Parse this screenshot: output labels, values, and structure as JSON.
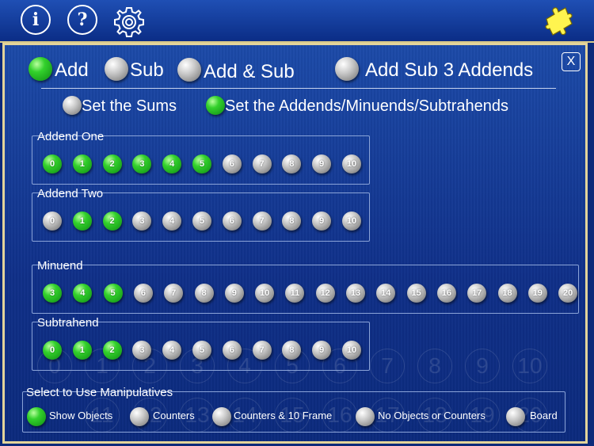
{
  "toolbar": {
    "info_label": "i",
    "help_label": "?",
    "settings_icon": "gear-icon",
    "puzzle_icon": "puzzle-piece-icon"
  },
  "operations": {
    "items": [
      {
        "label": "Add",
        "selected": true
      },
      {
        "label": "Sub",
        "selected": false
      },
      {
        "label": "Add & Sub",
        "selected": false
      },
      {
        "label": "Add Sub 3 Addends",
        "selected": false
      }
    ],
    "close_label": "X"
  },
  "modes": {
    "items": [
      {
        "label": "Set the Sums",
        "selected": false
      },
      {
        "label": "Set the Addends/Minuends/Subtrahends",
        "selected": true
      }
    ]
  },
  "addend_one": {
    "title": "Addend One",
    "numbers": [
      "0",
      "1",
      "2",
      "3",
      "4",
      "5",
      "6",
      "7",
      "8",
      "9",
      "10"
    ],
    "selected": [
      true,
      true,
      true,
      true,
      true,
      true,
      false,
      false,
      false,
      false,
      false
    ]
  },
  "addend_two": {
    "title": "Addend Two",
    "numbers": [
      "0",
      "1",
      "2",
      "3",
      "4",
      "5",
      "6",
      "7",
      "8",
      "9",
      "10"
    ],
    "selected": [
      false,
      true,
      true,
      false,
      false,
      false,
      false,
      false,
      false,
      false,
      false
    ]
  },
  "minuend": {
    "title": "Minuend",
    "numbers": [
      "3",
      "4",
      "5",
      "6",
      "7",
      "8",
      "9",
      "10",
      "11",
      "12",
      "13",
      "14",
      "15",
      "16",
      "17",
      "18",
      "19",
      "20"
    ],
    "selected": [
      true,
      true,
      true,
      false,
      false,
      false,
      false,
      false,
      false,
      false,
      false,
      false,
      false,
      false,
      false,
      false,
      false,
      false
    ]
  },
  "subtrahend": {
    "title": "Subtrahend",
    "numbers": [
      "0",
      "1",
      "2",
      "3",
      "4",
      "5",
      "6",
      "7",
      "8",
      "9",
      "10"
    ],
    "selected": [
      true,
      true,
      true,
      false,
      false,
      false,
      false,
      false,
      false,
      false,
      false
    ]
  },
  "background_board": {
    "row1": [
      "0",
      "1",
      "2",
      "3",
      "4",
      "5",
      "6",
      "7",
      "8",
      "9",
      "10"
    ],
    "row2": [
      "11",
      "12",
      "13",
      "14",
      "15",
      "16",
      "17",
      "18",
      "19",
      "20"
    ]
  },
  "manipulatives": {
    "title": "Select to Use Manipulatives",
    "options": [
      {
        "label": "Show Objects",
        "selected": true
      },
      {
        "label": "Counters",
        "selected": false
      },
      {
        "label": "Counters & 10 Frame",
        "selected": false
      },
      {
        "label": "No Objects or Counters",
        "selected": false
      },
      {
        "label": "Board",
        "selected": false
      }
    ]
  },
  "colors": {
    "selected_green": "#33d12c",
    "unselected_gray": "#c9c9c9",
    "panel_border": "#e3d49a",
    "background_blue": "#0f2f88"
  }
}
